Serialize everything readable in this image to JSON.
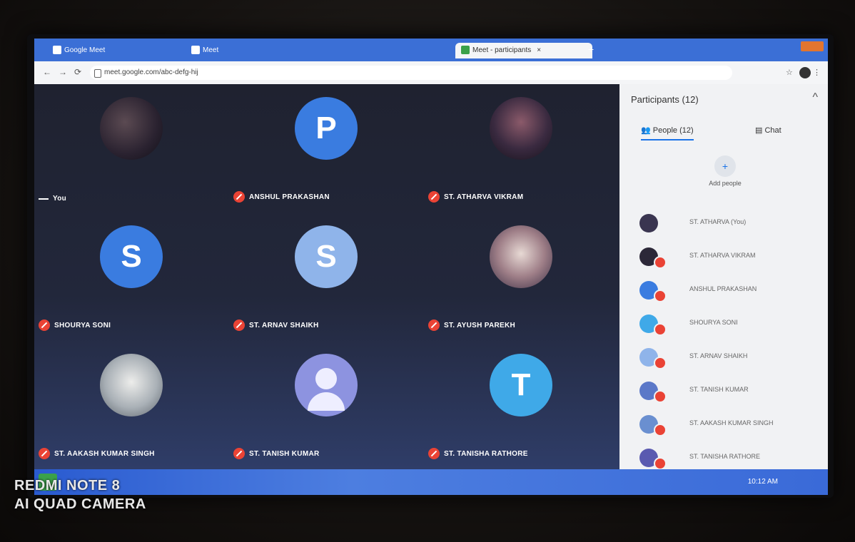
{
  "browser": {
    "tabs": [
      {
        "label": "Google Meet"
      },
      {
        "label": "Meet"
      }
    ],
    "active_tab": {
      "label": "Meet - participants"
    },
    "new_tab_symbol": "+",
    "url": "meet.google.com/abc-defg-hij",
    "nav": {
      "back": "←",
      "forward": "→",
      "reload": "⟳"
    }
  },
  "tiles": [
    {
      "name": "You",
      "avatar_letter": "",
      "avatar_type": "photo",
      "muted": false
    },
    {
      "name": "ANSHUL PRAKASHAN",
      "avatar_letter": "P",
      "avatar_type": "letter",
      "color": "#3a7ce0",
      "muted": true
    },
    {
      "name": "ST. ATHARVA VIKRAM",
      "avatar_letter": "",
      "avatar_type": "photo4",
      "muted": true
    },
    {
      "name": "SHOURYA SONI",
      "avatar_letter": "S",
      "avatar_type": "letter",
      "color": "#3a7ce0",
      "muted": true
    },
    {
      "name": "ST. ARNAV SHAIKH",
      "avatar_letter": "S",
      "avatar_type": "letter",
      "color": "#8fb4ea",
      "muted": true
    },
    {
      "name": "ST. AYUSH PAREKH",
      "avatar_letter": "",
      "avatar_type": "photo2",
      "muted": true
    },
    {
      "name": "ST. AAKASH KUMAR SINGH",
      "avatar_letter": "",
      "avatar_type": "photo3",
      "muted": true
    },
    {
      "name": "ST. TANISH KUMAR",
      "avatar_letter": "",
      "avatar_type": "generic",
      "muted": true
    },
    {
      "name": "ST. TANISHA RATHORE",
      "avatar_letter": "T",
      "avatar_type": "letter",
      "color": "#3fa9e8",
      "muted": true
    }
  ],
  "panel": {
    "title": "Participants (12)",
    "close_symbol": "^",
    "tabs": [
      {
        "label": "People (12)"
      },
      {
        "label": "Chat"
      }
    ],
    "add_people": {
      "label": "Add people",
      "symbol": "+"
    },
    "participants": [
      {
        "name": "ST. ATHARVA (You)",
        "color": "#3a3550"
      },
      {
        "name": "ST. ATHARVA VIKRAM",
        "color": "#2c2838"
      },
      {
        "name": "ANSHUL PRAKASHAN",
        "color": "#3a7ce0"
      },
      {
        "name": "SHOURYA SONI",
        "color": "#3fa9e8"
      },
      {
        "name": "ST. ARNAV SHAIKH",
        "color": "#8fb4ea"
      },
      {
        "name": "ST. TANISH KUMAR",
        "color": "#5b78c8"
      },
      {
        "name": "ST. AAKASH KUMAR SINGH",
        "color": "#6a8fd0"
      },
      {
        "name": "ST. TANISHA RATHORE",
        "color": "#5a5ab0"
      }
    ]
  },
  "taskbar": {
    "clock": "10:12 AM"
  },
  "watermark": {
    "line1": "REDMI NOTE 8",
    "line2": "AI QUAD CAMERA"
  }
}
